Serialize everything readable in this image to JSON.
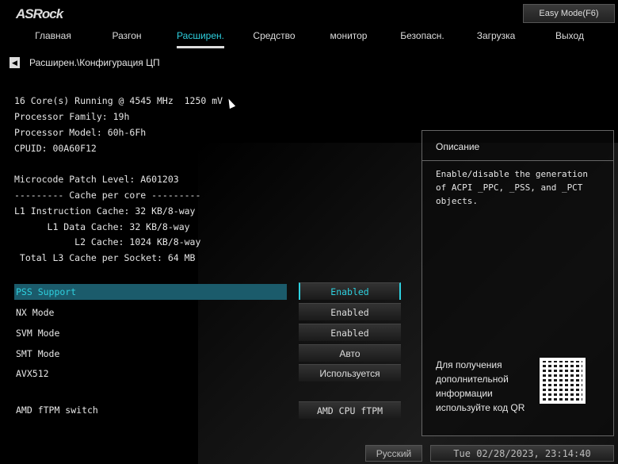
{
  "header": {
    "logo": "ASRock",
    "easy_mode": "Easy Mode(F6)"
  },
  "tabs": [
    {
      "label": "Главная"
    },
    {
      "label": "Разгон"
    },
    {
      "label": "Расширен."
    },
    {
      "label": "Средство"
    },
    {
      "label": "монитор"
    },
    {
      "label": "Безопасн."
    },
    {
      "label": "Загрузка"
    },
    {
      "label": "Выход"
    }
  ],
  "breadcrumb": "Расширен.\\Конфигурация ЦП",
  "info": [
    "16 Core(s) Running @ 4545 MHz  1250 mV",
    "Processor Family: 19h",
    "Processor Model: 60h-6Fh",
    "CPUID: 00A60F12",
    "",
    "Microcode Patch Level: A601203",
    "--------- Cache per core ---------",
    "L1 Instruction Cache: 32 KB/8-way",
    "      L1 Data Cache: 32 KB/8-way",
    "           L2 Cache: 1024 KB/8-way",
    " Total L3 Cache per Socket: 64 MB"
  ],
  "settings": [
    {
      "label": "PSS Support",
      "value": "Enabled"
    },
    {
      "label": "NX Mode",
      "value": "Enabled"
    },
    {
      "label": "SVM Mode",
      "value": "Enabled"
    },
    {
      "label": "SMT Mode",
      "value": "Авто"
    },
    {
      "label": "AVX512",
      "value": "Используется"
    },
    {
      "label": "AMD fTPM switch",
      "value": "AMD CPU fTPM"
    }
  ],
  "description": {
    "title": "Описание",
    "text": "Enable/disable the generation of ACPI _PPC, _PSS, and _PCT objects.",
    "help": "Для получения дополнительной информации используйте код QR"
  },
  "footer": {
    "language": "Русский",
    "datetime": "Tue 02/28/2023, 23:14:40"
  },
  "colors": {
    "accent": "#2ed0df"
  }
}
